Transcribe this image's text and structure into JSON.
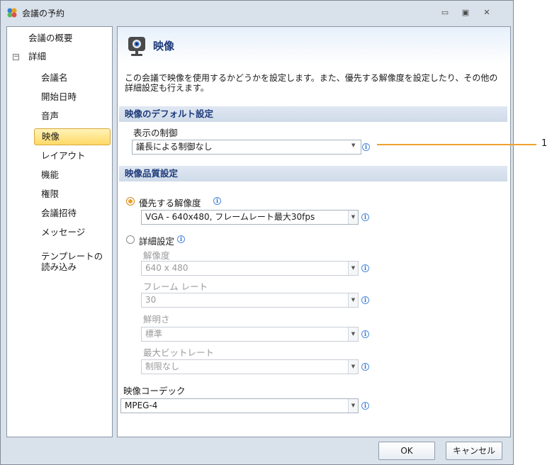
{
  "window": {
    "title": "会議の予約",
    "min_glyph": "▭",
    "max_glyph": "▣",
    "close_glyph": "✕"
  },
  "sidebar": {
    "items": [
      {
        "label": "会議の概要"
      },
      {
        "label": "詳細"
      },
      {
        "label": "会議名"
      },
      {
        "label": "開始日時"
      },
      {
        "label": "音声"
      },
      {
        "label": "映像"
      },
      {
        "label": "レイアウト"
      },
      {
        "label": "機能"
      },
      {
        "label": "権限"
      },
      {
        "label": "会議招待"
      },
      {
        "label": "メッセージ"
      },
      {
        "label": "テンプレートの読み込み"
      }
    ],
    "active": "映像",
    "toggle_glyph": "−"
  },
  "content": {
    "title": "映像",
    "description": "この会議で映像を使用するかどうかを設定します。また、優先する解像度を設定したり、その他の詳細設定も行えます。",
    "section_default": "映像のデフォルト設定",
    "display_control_label": "表示の制御",
    "display_control_value": "議長による制御なし",
    "section_quality": "映像品質設定",
    "preferred_resolution_label": "優先する解像度",
    "preferred_resolution_value": "VGA - 640x480, フレームレート最大30fps",
    "advanced_label": "詳細設定",
    "resolution_label": "解像度",
    "resolution_value": "640 x 480",
    "framerate_label": "フレーム レート",
    "framerate_value": "30",
    "sharpness_label": "鮮明さ",
    "sharpness_value": "標準",
    "max_bitrate_label": "最大ビットレート",
    "max_bitrate_value": "制限なし",
    "codec_label": "映像コーデック",
    "codec_value": "MPEG-4",
    "info_glyph": "i",
    "arrow_glyph": "▼"
  },
  "footer": {
    "ok": "OK",
    "cancel": "キャンセル"
  },
  "callout": {
    "number": "1",
    "color": "#f0a030"
  }
}
